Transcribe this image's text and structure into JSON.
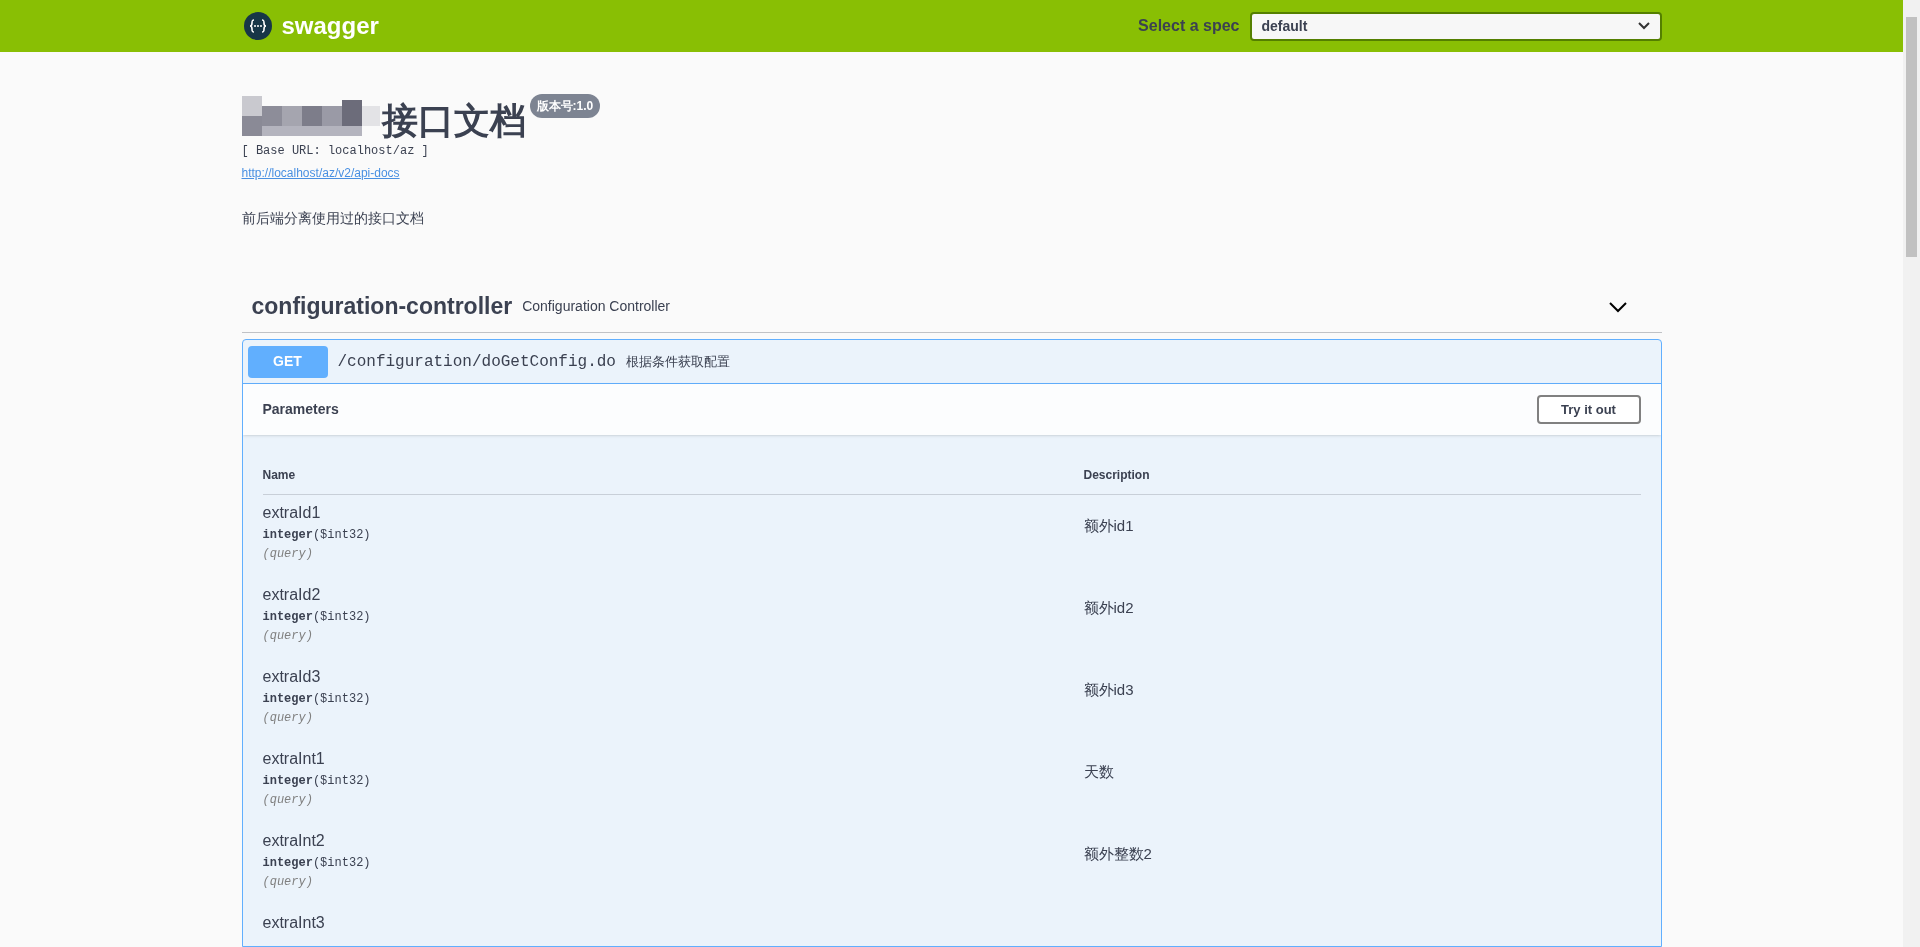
{
  "topbar": {
    "brand": "swagger",
    "spec_label": "Select a spec",
    "spec_value": "default"
  },
  "info": {
    "title": "接口文档",
    "version": "版本号:1.0",
    "base_url": "[ Base URL: localhost/az ]",
    "docs_link": "http://localhost/az/v2/api-docs",
    "description": "前后端分离使用过的接口文档"
  },
  "tag": {
    "name": "configuration-controller",
    "description": "Configuration Controller",
    "expanded": true
  },
  "operation": {
    "method": "GET",
    "path": "/configuration/doGetConfig.do",
    "summary": "根据条件获取配置"
  },
  "parameters": {
    "title": "Parameters",
    "try_button": "Try it out",
    "columns": [
      "Name",
      "Description"
    ],
    "rows": [
      {
        "name": "extraId1",
        "type": "integer",
        "format": "($int32)",
        "location": "(query)",
        "description": "额外id1"
      },
      {
        "name": "extraId2",
        "type": "integer",
        "format": "($int32)",
        "location": "(query)",
        "description": "额外id2"
      },
      {
        "name": "extraId3",
        "type": "integer",
        "format": "($int32)",
        "location": "(query)",
        "description": "额外id3"
      },
      {
        "name": "extraInt1",
        "type": "integer",
        "format": "($int32)",
        "location": "(query)",
        "description": "天数"
      },
      {
        "name": "extraInt2",
        "type": "integer",
        "format": "($int32)",
        "location": "(query)",
        "description": "额外整数2"
      },
      {
        "name": "extraInt3"
      }
    ]
  }
}
